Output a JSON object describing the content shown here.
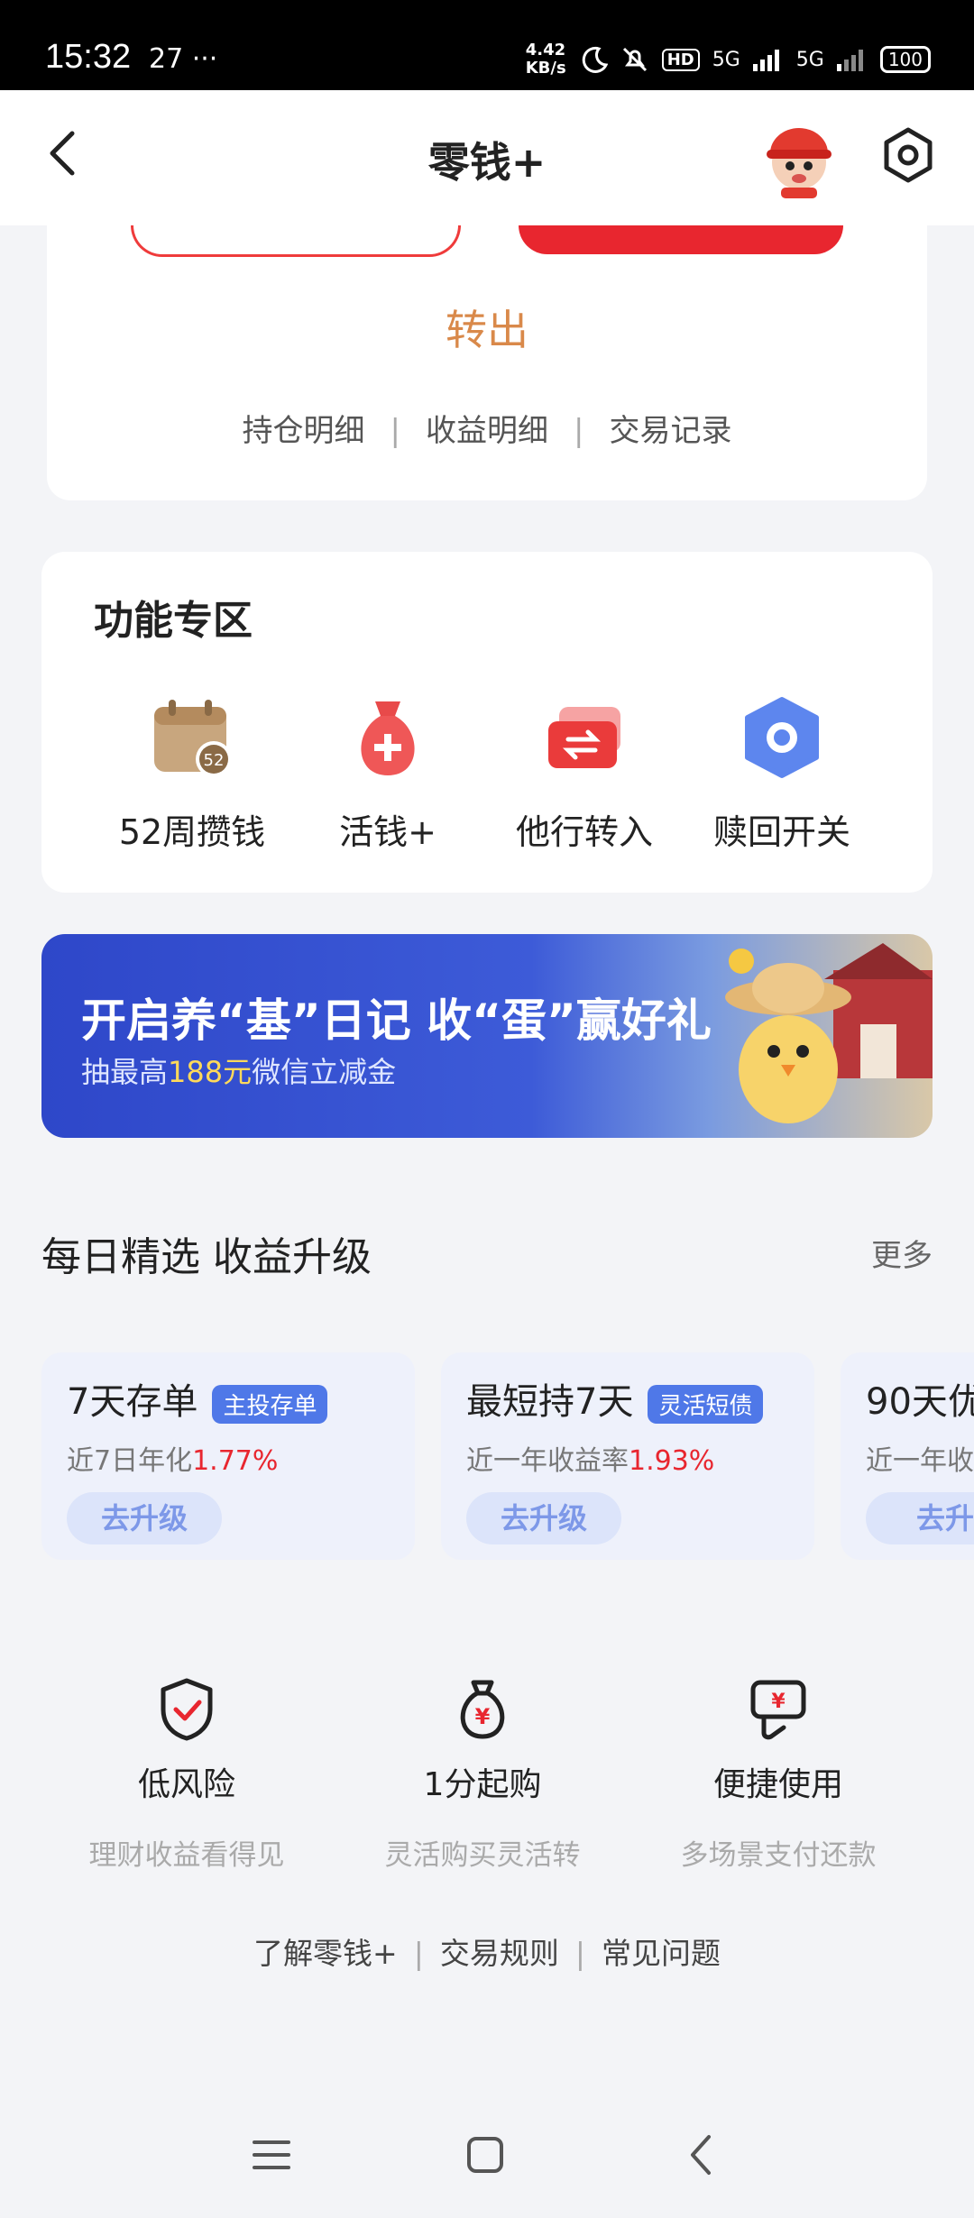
{
  "status_bar": {
    "time": "15:32",
    "notification_icons": "27 ···",
    "net_speed_value": "4.42",
    "net_speed_unit": "KB/s",
    "hd_label": "HD",
    "signal_1": "5G",
    "signal_2": "5G",
    "battery": "100"
  },
  "header": {
    "title": "零钱+"
  },
  "top_card": {
    "transfer_out_label": "转出",
    "links": [
      "持仓明细",
      "收益明细",
      "交易记录"
    ]
  },
  "functions": {
    "title": "功能专区",
    "items": [
      {
        "label": "52周攒钱",
        "icon": "calendar-52-icon",
        "badge": "52"
      },
      {
        "label": "活钱+",
        "icon": "money-bag-plus-icon"
      },
      {
        "label": "他行转入",
        "icon": "card-transfer-icon"
      },
      {
        "label": "赎回开关",
        "icon": "hexagon-switch-icon"
      }
    ]
  },
  "banner": {
    "headline": "开启养“基”日记 收“蛋”赢好礼",
    "sub_prefix": "抽最高",
    "sub_highlight": "188元",
    "sub_suffix": "微信立减金"
  },
  "daily": {
    "title": "每日精选 收益升级",
    "more_label": "更多",
    "products": [
      {
        "name": "7天存单",
        "tag": "主投存单",
        "rate_label": "近7日年化",
        "rate_value": "1.77%",
        "button": "去升级"
      },
      {
        "name": "最短持7天",
        "tag": "灵活短债",
        "rate_label": "近一年收益率",
        "rate_value": "1.93%",
        "button": "去升级"
      },
      {
        "name": "90天优",
        "tag": "",
        "rate_label": "近一年收",
        "rate_value": "",
        "button": "去升"
      }
    ]
  },
  "features": [
    {
      "title": "低风险",
      "subtitle": "理财收益看得见",
      "icon": "shield-check-icon"
    },
    {
      "title": "1分起购",
      "subtitle": "灵活购买灵活转",
      "icon": "yuan-bag-icon"
    },
    {
      "title": "便捷使用",
      "subtitle": "多场景支付还款",
      "icon": "hand-card-icon"
    }
  ],
  "bottom_links": [
    "了解零钱+",
    "交易规则",
    "常见问题"
  ],
  "colors": {
    "accent_red": "#e8262f",
    "blue": "#4f78e8",
    "orange": "#d9894a"
  }
}
